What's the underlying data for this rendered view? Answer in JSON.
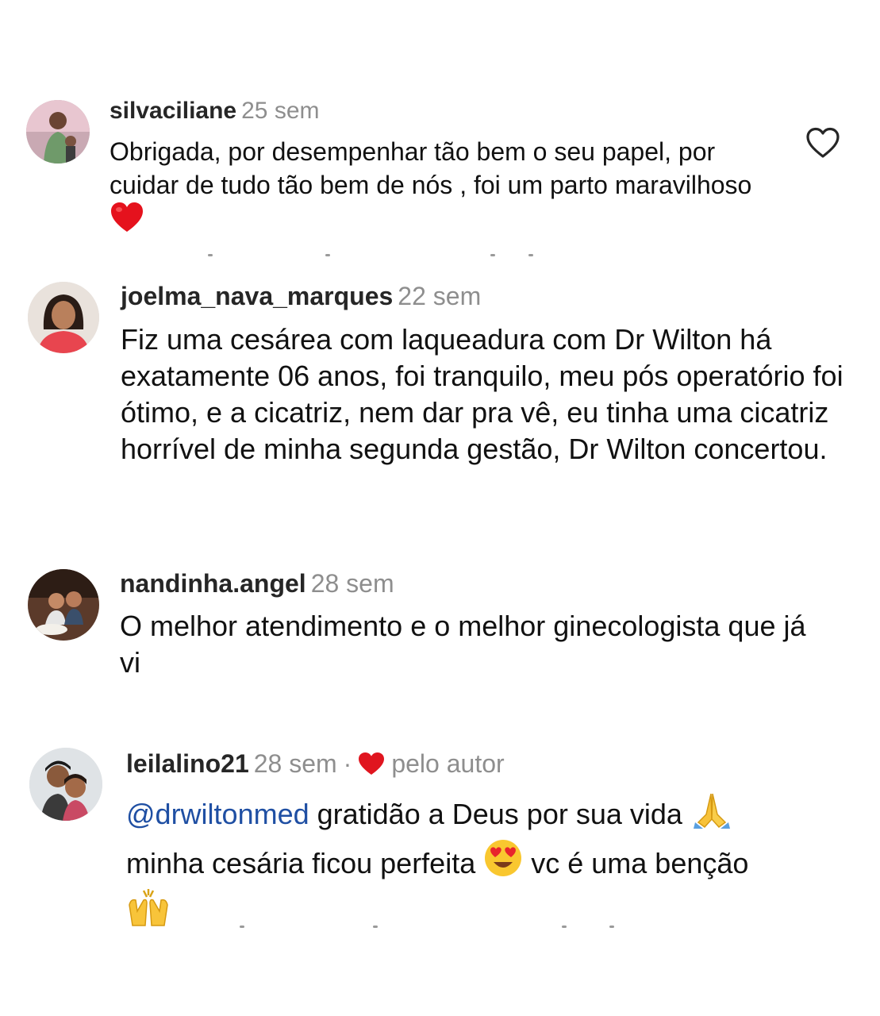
{
  "comments": [
    {
      "username": "silvaciliane",
      "time": "25 sem",
      "text": "Obrigada, por desempenhar tão bem o seu papel, por cuidar de tudo tão bem de nós , foi um parto maravilhoso"
    },
    {
      "username": "joelma_nava_marques",
      "time": "22 sem",
      "text": "Fiz uma cesárea com laqueadura com Dr Wilton há exatamente 06 anos, foi tranquilo, meu pós operatório foi ótimo, e a cicatriz, nem dar pra vê, eu tinha uma cicatriz horrível de minha segunda gestão, Dr Wilton concertou."
    },
    {
      "username": "nandinha.angel",
      "time": "28 sem",
      "text": "O melhor atendimento e o melhor ginecologista que já vi"
    },
    {
      "username": "leilalino21",
      "time": "28 sem",
      "separator": "·",
      "author_badge": "pelo autor",
      "mention": "@drwiltonmed",
      "text": " gratidão a Deus por sua vida",
      "text_line2": "minha cesária ficou perfeita",
      "text_line2b": " vc é uma benção"
    }
  ],
  "icons": {
    "like": "heart-outline-icon",
    "author_like": "heart-filled-icon",
    "emoji_heart": "red-heart-emoji",
    "emoji_pray": "folded-hands-emoji",
    "emoji_heart_eyes": "heart-eyes-emoji",
    "emoji_raise": "raising-hands-emoji"
  },
  "colors": {
    "username": "#262626",
    "meta": "#8e8e8e",
    "mention": "#1f4fa3",
    "heart": "#e0151f"
  }
}
